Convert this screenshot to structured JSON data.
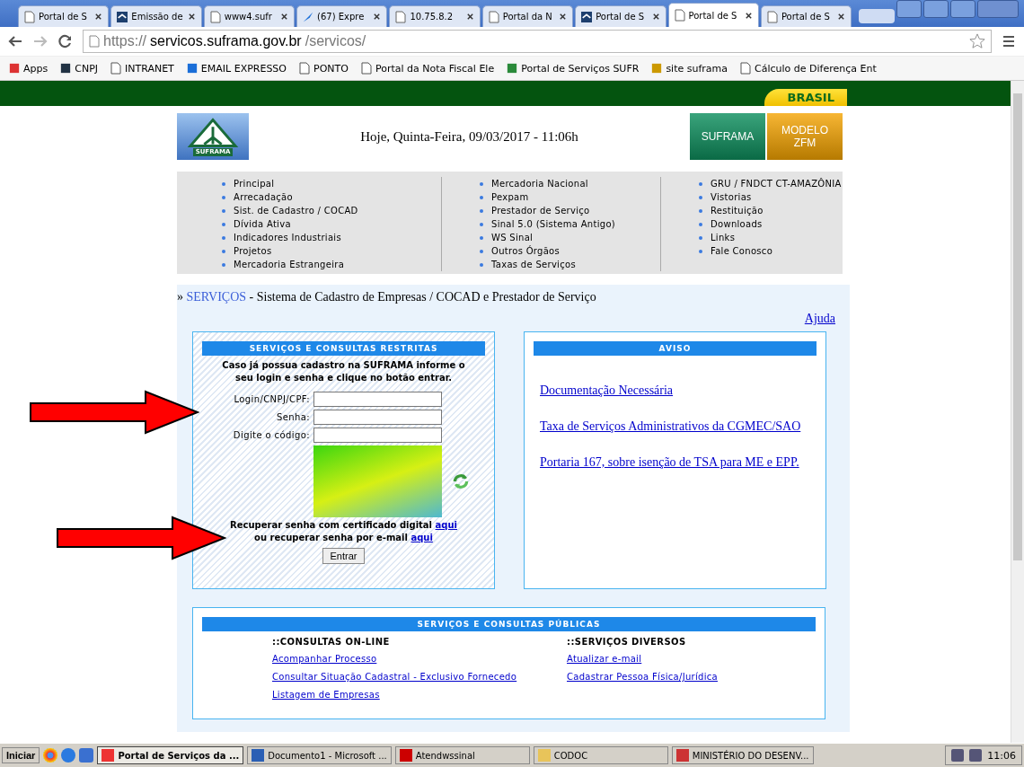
{
  "browser": {
    "tabs": [
      {
        "title": "Portal de S",
        "selected": false,
        "kind": "page"
      },
      {
        "title": "Emissão de",
        "selected": false,
        "kind": "site"
      },
      {
        "title": "www4.sufr",
        "selected": false,
        "kind": "page"
      },
      {
        "title": "(67) Expre",
        "selected": false,
        "kind": "mail"
      },
      {
        "title": "10.75.8.2",
        "selected": false,
        "kind": "page"
      },
      {
        "title": "Portal da N",
        "selected": false,
        "kind": "page"
      },
      {
        "title": "Portal de S",
        "selected": false,
        "kind": "site"
      },
      {
        "title": "Portal de S",
        "selected": true,
        "kind": "page"
      },
      {
        "title": "Portal de S",
        "selected": false,
        "kind": "page"
      }
    ],
    "url": {
      "scheme": "https://",
      "host": "servicos.suframa.gov.br",
      "path": "/servicos/"
    },
    "bookmarks": [
      {
        "label": "Apps",
        "kind": "apps"
      },
      {
        "label": "CNPJ",
        "kind": "site"
      },
      {
        "label": "INTRANET",
        "kind": "page"
      },
      {
        "label": "EMAIL EXPRESSO",
        "kind": "mail"
      },
      {
        "label": "PONTO",
        "kind": "page"
      },
      {
        "label": "Portal da Nota Fiscal Ele",
        "kind": "page"
      },
      {
        "label": "Portal de Serviços SUFR",
        "kind": "tree"
      },
      {
        "label": "site suframa",
        "kind": "flag"
      },
      {
        "label": "Cálculo de Diferença Ent",
        "kind": "page"
      }
    ]
  },
  "page": {
    "brasil": "BRASIL",
    "logo_text": "SUFRAMA",
    "date": "Hoje, Quinta-Feira, 09/03/2017 - 11:06h",
    "header_buttons": [
      {
        "label": "SUFRAMA",
        "kind": "green"
      },
      {
        "label": "MODELO ZFM",
        "kind": "orange"
      }
    ],
    "menu": [
      [
        "Principal",
        "Arrecadação",
        "Sist. de Cadastro / COCAD",
        "Dívida Ativa",
        "Indicadores Industriais",
        "Projetos",
        "Mercadoria Estrangeira"
      ],
      [
        "Mercadoria Nacional",
        "Pexpam",
        "Prestador de Serviço",
        "Sinal 5.0 (Sistema Antigo)",
        "WS Sinal",
        "Outros Órgãos",
        "Taxas de Serviços"
      ],
      [
        "GRU / FNDCT CT-AMAZÔNIA",
        "Vistorias",
        "Restituição",
        "Downloads",
        "Links",
        "Fale Conosco"
      ]
    ],
    "breadcrumb": {
      "prefix": "»",
      "link": "SERVIÇOS",
      "rest": "- Sistema de Cadastro de Empresas / COCAD e Prestador de Serviço"
    },
    "help": "Ajuda",
    "restricted": {
      "title": "SERVIÇOS E CONSULTAS RESTRITAS",
      "intro": "Caso já possua cadastro na SUFRAMA informe o seu login e senha e clique no botão entrar.",
      "fields": [
        {
          "label": "Login/CNPJ/CPF:"
        },
        {
          "label": "Senha:"
        },
        {
          "label": "Digite o código:"
        }
      ],
      "recover": [
        {
          "text": "Recuperar senha com certificado digital",
          "link": "aqui"
        },
        {
          "text": "ou recuperar senha por e-mail",
          "link": "aqui"
        }
      ],
      "button": "Entrar"
    },
    "notice": {
      "title": "AVISO",
      "links": [
        "Documentação Necessária ",
        "Taxa de Serviços Administrativos da CGMEC/SAO ",
        "Portaria 167, sobre isenção de TSA para ME e EPP. "
      ]
    },
    "public": {
      "title": "SERVIÇOS E CONSULTAS PÚBLICAS",
      "columns": [
        {
          "heading": "::CONSULTAS ON-LINE",
          "links": [
            "Acompanhar Processo",
            "Consultar Situação Cadastral - Exclusivo Fornecedo",
            "Listagem de Empresas"
          ]
        },
        {
          "heading": "::SERVIÇOS DIVERSOS",
          "links": [
            "Atualizar e-mail",
            "Cadastrar Pessoa Física/Jurídica"
          ]
        }
      ]
    }
  },
  "taskbar": {
    "start": "Iniciar",
    "items": [
      {
        "label": "Portal de Serviços da ...",
        "selected": true,
        "kind": "chrome"
      },
      {
        "label": "Documento1 - Microsoft ...",
        "selected": false,
        "kind": "word"
      },
      {
        "label": "Atendwssinal",
        "selected": false,
        "kind": "app"
      },
      {
        "label": "CODOC",
        "selected": false,
        "kind": "folder"
      },
      {
        "label": "MINISTÉRIO DO DESENV...",
        "selected": false,
        "kind": "pdf"
      }
    ],
    "clock": "11:06"
  }
}
